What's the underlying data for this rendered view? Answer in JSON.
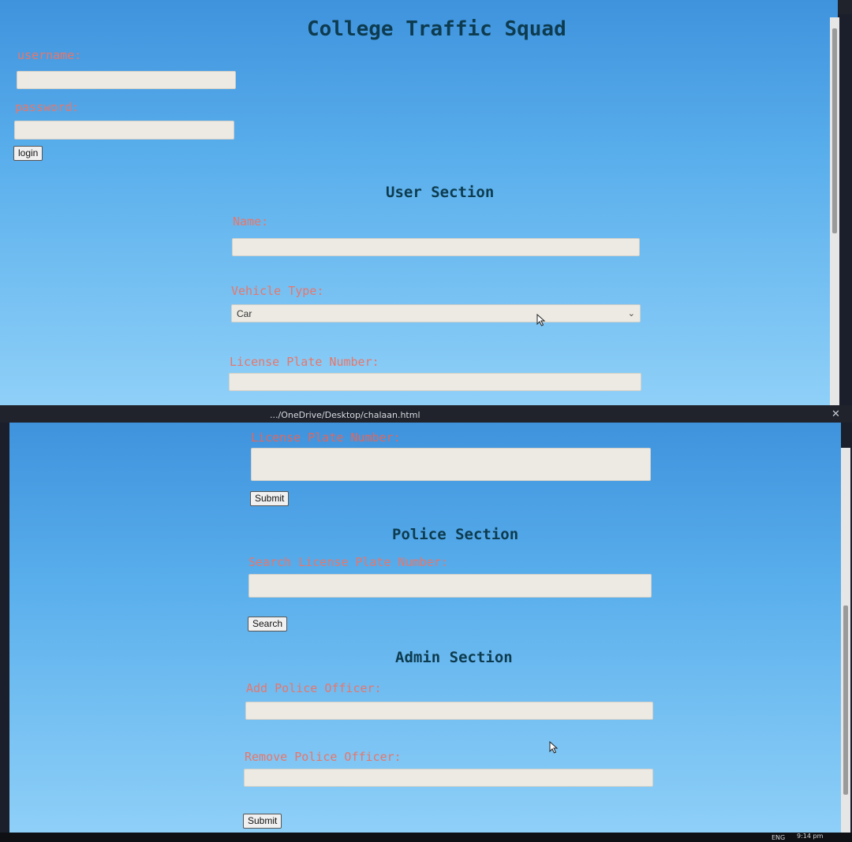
{
  "browser": {
    "address_path": ".../OneDrive/Desktop/chalaan.html",
    "time": "9:14 pm",
    "language": "ENG",
    "more_icon": "ellipsis-icon",
    "close_icon": "close-icon"
  },
  "page": {
    "title": "College Traffic Squad"
  },
  "login": {
    "username_label": "username:",
    "password_label": "password:",
    "login_button": "login"
  },
  "user_section": {
    "heading": "User Section",
    "name_label": "Name:",
    "vehicle_type_label": "Vehicle Type:",
    "vehicle_type_selected": "Car",
    "license_plate_label": "License Plate Number:",
    "submit_button": "Submit"
  },
  "police_section": {
    "heading": "Police Section",
    "search_label": "Search License Plate Number:",
    "search_button": "Search"
  },
  "admin_section": {
    "heading": "Admin Section",
    "add_officer_label": "Add Police Officer:",
    "remove_officer_label": "Remove Police Officer:",
    "submit_button": "Submit"
  },
  "colors": {
    "label": "#e8766a",
    "heading": "#0d3b4f",
    "background_top": "#3f93dd",
    "background_bottom": "#8fd0f8"
  }
}
